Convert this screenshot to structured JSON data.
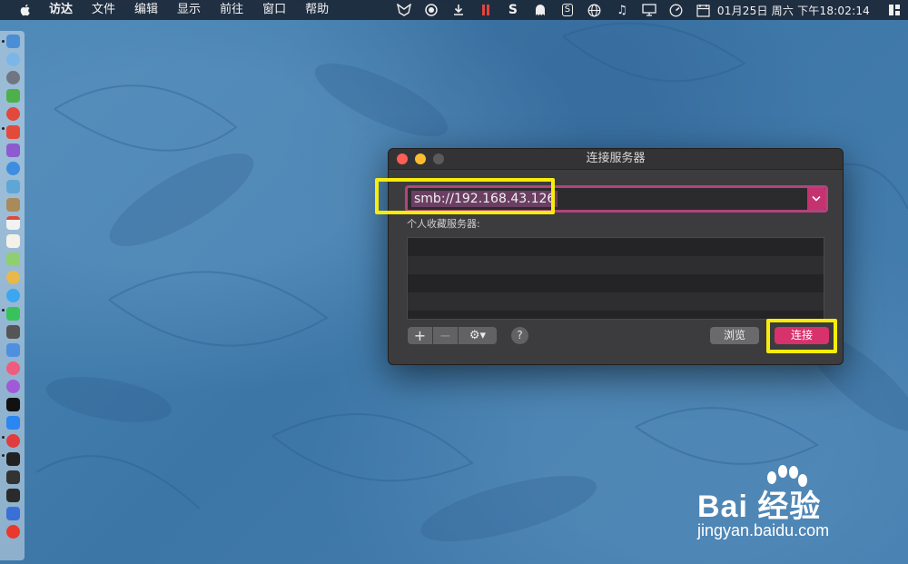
{
  "menubar": {
    "app_name": "访达",
    "items": [
      "文件",
      "编辑",
      "显示",
      "前往",
      "窗口",
      "帮助"
    ],
    "clock": "01月25日 周六 下午18:02:14",
    "date_badge": "25"
  },
  "dialog": {
    "title": "连接服务器",
    "address_value": "smb://192.168.43.126",
    "favorites_label": "个人收藏服务器:",
    "add_label": "+",
    "remove_label": "−",
    "gear_label": "⚙▾",
    "help_label": "?",
    "browse_label": "浏览",
    "connect_label": "连接"
  },
  "watermark": {
    "brand": "Bai 经验",
    "site": "jingyan.baidu.com"
  },
  "colors": {
    "accent": "#d8326d",
    "highlight": "#f8ec0c",
    "dialog_bg": "#3c3c3e"
  }
}
